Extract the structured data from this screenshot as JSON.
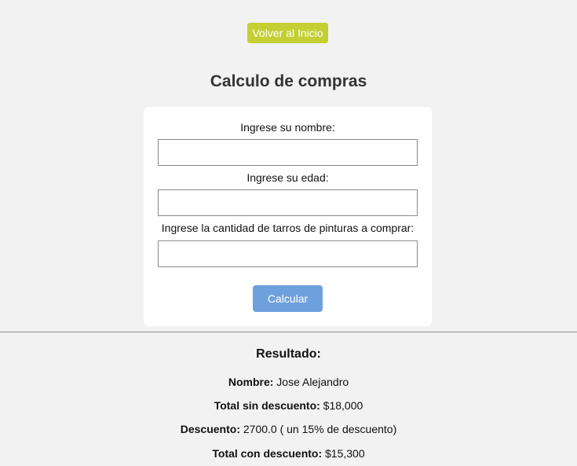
{
  "nav": {
    "back_label": "Volver al Inicio"
  },
  "page": {
    "title": "Calculo de compras"
  },
  "form": {
    "name_label": "Ingrese su nombre:",
    "name_value": "",
    "age_label": "Ingrese su edad:",
    "age_value": "",
    "quantity_label": "Ingrese la cantidad de tarros de pinturas a comprar:",
    "quantity_value": "",
    "submit_label": "Calcular"
  },
  "result": {
    "title": "Resultado:",
    "name_label": "Nombre:",
    "name_value": " Jose Alejandro",
    "subtotal_label": "Total sin descuento:",
    "subtotal_value": " $18,000",
    "discount_label": "Descuento:",
    "discount_value": " 2700.0 ( un 15% de descuento)",
    "total_label": "Total con descuento:",
    "total_value": " $15,300"
  },
  "colors": {
    "back_button": "#c3cf32",
    "calc_button": "#6fa0de",
    "background": "#f2f2f2",
    "card": "#ffffff"
  }
}
